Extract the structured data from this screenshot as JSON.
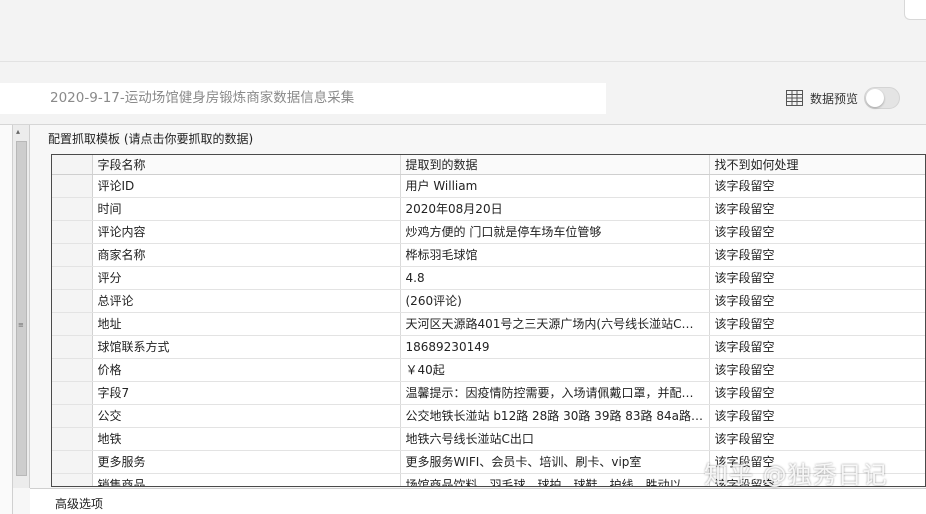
{
  "task": {
    "title_value": "2020-9-17-运动场馆健身房锻炼商家数据信息采集"
  },
  "preview": {
    "label": "数据预览",
    "enabled": false,
    "icon": "table-grid-icon"
  },
  "section": {
    "label": "配置抓取模板 (请点击你要抓取的数据)"
  },
  "table": {
    "columns": [
      "字段名称",
      "提取到的数据",
      "找不到如何处理"
    ],
    "rows": [
      {
        "field": "评论ID",
        "value": "用户 William",
        "fallback": "该字段留空"
      },
      {
        "field": "时间",
        "value": "2020年08月20日",
        "fallback": "该字段留空"
      },
      {
        "field": "评论内容",
        "value": "炒鸡方便的  门口就是停车场车位管够",
        "fallback": "该字段留空"
      },
      {
        "field": "商家名称",
        "value": "桦标羽毛球馆",
        "fallback": "该字段留空"
      },
      {
        "field": "评分",
        "value": "4.8",
        "fallback": "该字段留空"
      },
      {
        "field": "总评论",
        "value": "(260评论)",
        "fallback": "该字段留空"
      },
      {
        "field": "地址",
        "value": "天河区天源路401号之三天源广场内(六号线长湴站C出...",
        "fallback": "该字段留空"
      },
      {
        "field": "球馆联系方式",
        "value": "18689230149",
        "fallback": "该字段留空"
      },
      {
        "field": "价格",
        "value": "￥40起",
        "fallback": "该字段留空"
      },
      {
        "field": "字段7",
        "value": "温馨提示：因疫情防控需要，入场请佩戴口罩，并配合...",
        "fallback": "该字段留空"
      },
      {
        "field": "公交",
        "value": "公交地铁长湴站  b12路 28路 30路 39路 83路 84a路 ...",
        "fallback": "该字段留空"
      },
      {
        "field": "地铁",
        "value": "地铁六号线长湴站C出口",
        "fallback": "该字段留空"
      },
      {
        "field": "更多服务",
        "value": "更多服务WIFI、会员卡、培训、刷卡、vip室",
        "fallback": "该字段留空"
      },
      {
        "field": "销售商品",
        "value": "场馆商品饮料、羽毛球、球拍、球鞋、护线、胜动以其...",
        "fallback": "该字段留空"
      }
    ]
  },
  "bottom": {
    "advanced_label": "高级选项"
  },
  "watermark": {
    "text": "知乎 @独秀日记"
  }
}
